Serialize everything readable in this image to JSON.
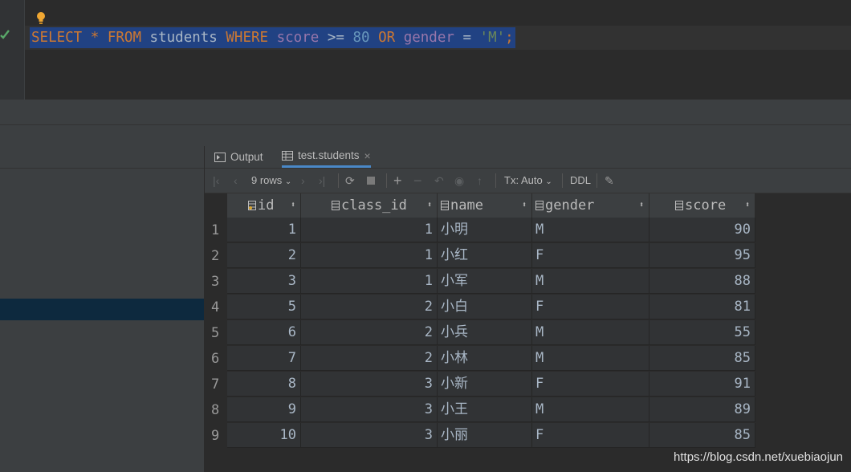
{
  "editor": {
    "sql_tokens": [
      {
        "t": "SELECT",
        "c": "kw"
      },
      {
        "t": " ",
        "c": "plain"
      },
      {
        "t": "*",
        "c": "kw"
      },
      {
        "t": " ",
        "c": "plain"
      },
      {
        "t": "FROM",
        "c": "kw"
      },
      {
        "t": " students ",
        "c": "plain"
      },
      {
        "t": "WHERE",
        "c": "kw"
      },
      {
        "t": " ",
        "c": "plain"
      },
      {
        "t": "score",
        "c": "col"
      },
      {
        "t": " >= ",
        "c": "plain"
      },
      {
        "t": "80",
        "c": "num"
      },
      {
        "t": " ",
        "c": "plain"
      },
      {
        "t": "OR",
        "c": "kw"
      },
      {
        "t": " ",
        "c": "plain"
      },
      {
        "t": "gender",
        "c": "col"
      },
      {
        "t": " = ",
        "c": "plain"
      },
      {
        "t": "'M'",
        "c": "str"
      },
      {
        "t": ";",
        "c": "kw"
      }
    ]
  },
  "tabs": {
    "output": "Output",
    "table": "test.students"
  },
  "toolbar": {
    "rows": "9 rows",
    "tx": "Tx: Auto",
    "ddl": "DDL"
  },
  "columns": [
    "id",
    "class_id",
    "name",
    "gender",
    "score"
  ],
  "rows": [
    {
      "n": "1",
      "id": "1",
      "class_id": "1",
      "name": "小明",
      "gender": "M",
      "score": "90"
    },
    {
      "n": "2",
      "id": "2",
      "class_id": "1",
      "name": "小红",
      "gender": "F",
      "score": "95"
    },
    {
      "n": "3",
      "id": "3",
      "class_id": "1",
      "name": "小军",
      "gender": "M",
      "score": "88"
    },
    {
      "n": "4",
      "id": "5",
      "class_id": "2",
      "name": "小白",
      "gender": "F",
      "score": "81"
    },
    {
      "n": "5",
      "id": "6",
      "class_id": "2",
      "name": "小兵",
      "gender": "M",
      "score": "55"
    },
    {
      "n": "6",
      "id": "7",
      "class_id": "2",
      "name": "小林",
      "gender": "M",
      "score": "85"
    },
    {
      "n": "7",
      "id": "8",
      "class_id": "3",
      "name": "小新",
      "gender": "F",
      "score": "91"
    },
    {
      "n": "8",
      "id": "9",
      "class_id": "3",
      "name": "小王",
      "gender": "M",
      "score": "89"
    },
    {
      "n": "9",
      "id": "10",
      "class_id": "3",
      "name": "小丽",
      "gender": "F",
      "score": "85"
    }
  ],
  "watermark": "https://blog.csdn.net/xuebiaojun"
}
